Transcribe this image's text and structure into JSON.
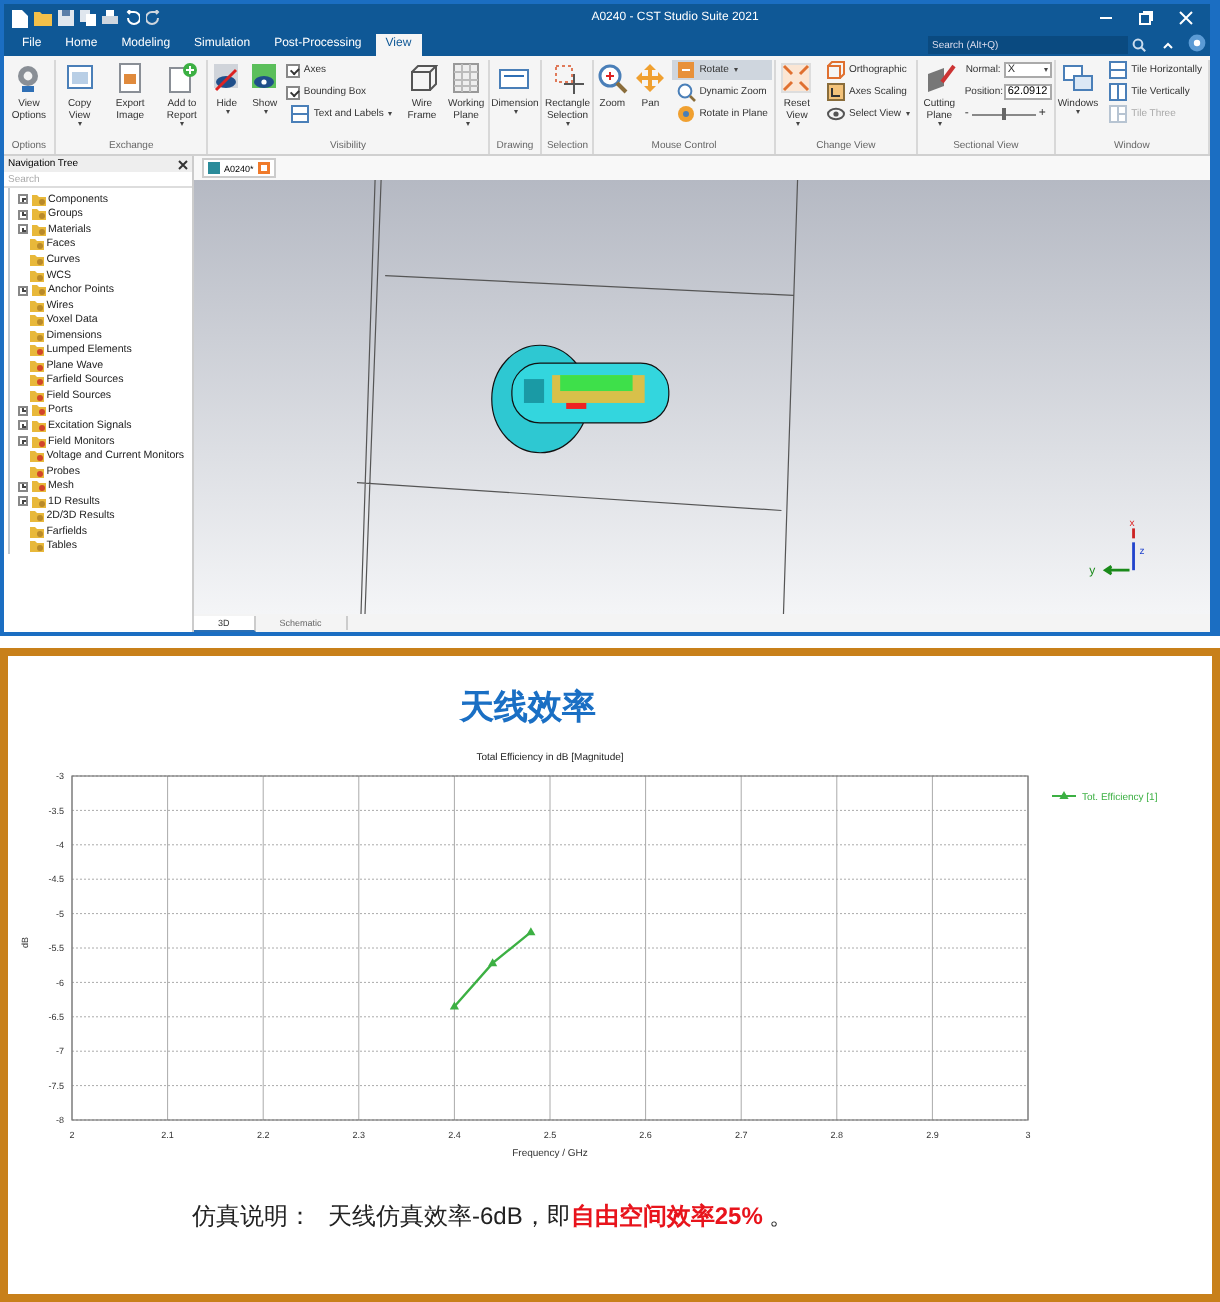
{
  "window": {
    "title": "A0240 - CST Studio Suite 2021",
    "search": {
      "placeholder": "Search (Alt+Q)"
    }
  },
  "menu_tabs": [
    {
      "label": "File",
      "selected": false
    },
    {
      "label": "Home",
      "selected": false
    },
    {
      "label": "Modeling",
      "selected": false
    },
    {
      "label": "Simulation",
      "selected": false
    },
    {
      "label": "Post-Processing",
      "selected": false
    },
    {
      "label": "View",
      "selected": true
    }
  ],
  "ribbon_groups": [
    {
      "label": "Options",
      "items": [
        {
          "kind": "large",
          "label": "View Options",
          "dropdown": false
        }
      ]
    },
    {
      "label": "Exchange",
      "items": [
        {
          "kind": "large",
          "label": "Copy View",
          "dropdown": true
        },
        {
          "kind": "large",
          "label": "Export Image",
          "dropdown": false
        },
        {
          "kind": "large",
          "label": "Add to Report",
          "dropdown": true
        }
      ]
    },
    {
      "label": "Visibility",
      "items": [
        {
          "kind": "large",
          "label": "Hide",
          "dropdown": true
        },
        {
          "kind": "large",
          "label": "Show",
          "dropdown": true
        },
        {
          "kind": "stack",
          "rows": [
            {
              "kind": "check",
              "label": "Axes",
              "checked": true
            },
            {
              "kind": "check",
              "label": "Bounding Box",
              "checked": true
            },
            {
              "kind": "small",
              "label": "Text and Labels",
              "dropdown": true
            }
          ]
        },
        {
          "kind": "large",
          "label": "Wire Frame",
          "dropdown": false
        },
        {
          "kind": "large",
          "label": "Working Plane",
          "dropdown": true
        }
      ]
    },
    {
      "label": "Drawing",
      "items": [
        {
          "kind": "large",
          "label": "Dimension",
          "dropdown": true
        }
      ]
    },
    {
      "label": "Selection",
      "items": [
        {
          "kind": "large",
          "label": "Rectangle Selection",
          "dropdown": true
        }
      ]
    },
    {
      "label": "Mouse Control",
      "items": [
        {
          "kind": "large",
          "label": "Zoom",
          "dropdown": false,
          "selected": false
        },
        {
          "kind": "large",
          "label": "Pan",
          "dropdown": false,
          "selected": false
        },
        {
          "kind": "stack",
          "rows": [
            {
              "kind": "small",
              "label": "Rotate",
              "dropdown": true,
              "selected": true
            },
            {
              "kind": "small",
              "label": "Dynamic Zoom",
              "dropdown": false,
              "selected": false
            },
            {
              "kind": "small",
              "label": "Rotate in Plane",
              "dropdown": false,
              "selected": false
            }
          ]
        }
      ]
    },
    {
      "label": "Change View",
      "items": [
        {
          "kind": "large",
          "label": "Reset View",
          "dropdown": true
        },
        {
          "kind": "stack",
          "rows": [
            {
              "kind": "small",
              "label": "Orthographic",
              "dropdown": false
            },
            {
              "kind": "small",
              "label": "Axes Scaling",
              "dropdown": false
            },
            {
              "kind": "small",
              "label": "Select View",
              "dropdown": true
            }
          ]
        }
      ]
    },
    {
      "label": "Sectional View",
      "items": [
        {
          "kind": "large",
          "label": "Cutting Plane",
          "dropdown": true
        },
        {
          "kind": "stack",
          "rows": [
            {
              "kind": "select",
              "label": "Normal:",
              "value": "X"
            },
            {
              "kind": "input",
              "label": "Position:",
              "value": "62.0912"
            },
            {
              "kind": "slider",
              "minus": "-",
              "plus": "+",
              "level": 0.5
            }
          ]
        }
      ]
    },
    {
      "label": "Window",
      "items": [
        {
          "kind": "large",
          "label": "Windows",
          "dropdown": true
        },
        {
          "kind": "stack",
          "rows": [
            {
              "kind": "small",
              "label": "Tile Horizontally",
              "disabled": false
            },
            {
              "kind": "small",
              "label": "Tile Vertically",
              "disabled": false
            },
            {
              "kind": "small",
              "label": "Tile Three",
              "disabled": true
            }
          ]
        }
      ]
    }
  ],
  "navigation_tree": {
    "title": "Navigation Tree",
    "search": {
      "placeholder": "Search"
    },
    "items": [
      {
        "label": "Components",
        "expandable": true
      },
      {
        "label": "Groups",
        "expandable": true
      },
      {
        "label": "Materials",
        "expandable": true
      },
      {
        "label": "Faces",
        "expandable": false
      },
      {
        "label": "Curves",
        "expandable": false
      },
      {
        "label": "WCS",
        "expandable": false
      },
      {
        "label": "Anchor Points",
        "expandable": true
      },
      {
        "label": "Wires",
        "expandable": false
      },
      {
        "label": "Voxel Data",
        "expandable": false
      },
      {
        "label": "Dimensions",
        "expandable": false
      },
      {
        "label": "Lumped Elements",
        "expandable": false
      },
      {
        "label": "Plane Wave",
        "expandable": false
      },
      {
        "label": "Farfield Sources",
        "expandable": false
      },
      {
        "label": "Field Sources",
        "expandable": false
      },
      {
        "label": "Ports",
        "expandable": true
      },
      {
        "label": "Excitation Signals",
        "expandable": true
      },
      {
        "label": "Field Monitors",
        "expandable": true
      },
      {
        "label": "Voltage and Current Monitors",
        "expandable": false
      },
      {
        "label": "Probes",
        "expandable": false
      },
      {
        "label": "Mesh",
        "expandable": true
      },
      {
        "label": "1D Results",
        "expandable": true
      },
      {
        "label": "2D/3D Results",
        "expandable": false
      },
      {
        "label": "Farfields",
        "expandable": false
      },
      {
        "label": "Tables",
        "expandable": false
      }
    ]
  },
  "document_tab": {
    "label": "A0240*"
  },
  "axis_labels": [
    "x",
    "z",
    "y"
  ],
  "view_tabs": [
    {
      "label": "3D",
      "selected": true
    },
    {
      "label": "Schematic",
      "selected": false
    }
  ],
  "report": {
    "title": "天线效率",
    "chart_data": {
      "type": "line",
      "title": "Total Efficiency in dB [Magnitude]",
      "xlabel": "Frequency / GHz",
      "ylabel": "dB",
      "x": [
        2.4,
        2.44,
        2.48
      ],
      "series": [
        {
          "name": "Tot. Efficiency [1]",
          "color": "#3cb043",
          "marker": "triangle",
          "values": [
            -6.35,
            -5.72,
            -5.27
          ]
        }
      ],
      "grid": true,
      "xlim": [
        2,
        3
      ],
      "ylim": [
        -8,
        -3
      ],
      "xticks": [
        2,
        2.1,
        2.2,
        2.3,
        2.4,
        2.5,
        2.6,
        2.7,
        2.8,
        2.9,
        3
      ],
      "yticks": [
        -3,
        -3.5,
        -4,
        -4.5,
        -5,
        -5.5,
        -6,
        -6.5,
        -7,
        -7.5,
        -8
      ]
    },
    "note_label": "仿真说明：",
    "note": "天线仿真效率-6dB，即**自由空间效率25%** 。"
  }
}
